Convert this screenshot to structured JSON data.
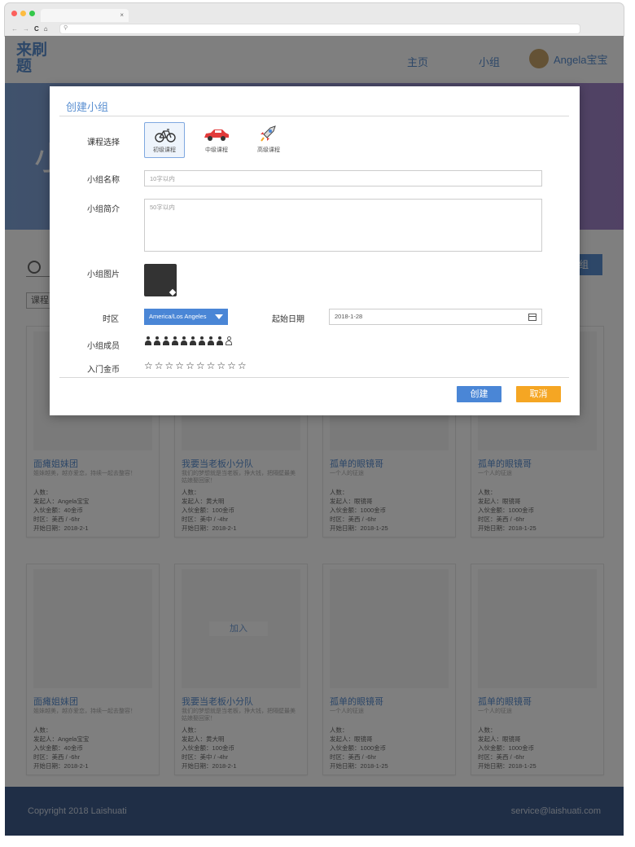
{
  "browser": {
    "tab_close": "×"
  },
  "header": {
    "logo": "来刷题",
    "nav": [
      "主页",
      "小组"
    ],
    "user_name": "Angela宝宝"
  },
  "banner": {
    "title": "小"
  },
  "search": {
    "button_label": "组"
  },
  "filter": {
    "course_label": "课程"
  },
  "cards": [
    {
      "title": "面瘫姐妹团",
      "desc": "姐妹越美，越亦爱恋，持续一起去整容！",
      "count_label": "人数：",
      "owner": "发起人：Angela宝宝",
      "fee": "入伙金额：40金币",
      "tz": "时区：美西 / -6hr",
      "start": "开始日期：2018-2-1"
    },
    {
      "title": "我要当老板小分队",
      "desc": "我们的梦想就是当老板，挣大钱，把隔壁最美姑娘娶回家！",
      "count_label": "人数：",
      "owner": "发起人：黄大明",
      "fee": "入伙金额：100金币",
      "tz": "时区：美中 / -4hr",
      "start": "开始日期：2018-2-1"
    },
    {
      "title": "孤单的眼镜哥",
      "desc": "一个人的征途",
      "count_label": "人数：",
      "owner": "发起人：眼镜哥",
      "fee": "入伙金额：1000金币",
      "tz": "时区：美西 / -6hr",
      "start": "开始日期：2018-1-25"
    },
    {
      "title": "孤单的眼镜哥",
      "desc": "一个人的征途",
      "count_label": "人数：",
      "owner": "发起人：眼镜哥",
      "fee": "入伙金额：1000金币",
      "tz": "时区：美西 / -6hr",
      "start": "开始日期：2018-1-25"
    },
    {
      "title": "面瘫姐妹团",
      "desc": "姐妹越美，越亦爱恋，持续一起去整容！",
      "count_label": "人数：",
      "owner": "发起人：Angela宝宝",
      "fee": "入伙金额：40金币",
      "tz": "时区：美西 / -6hr",
      "start": "开始日期：2018-2-1"
    },
    {
      "title": "我要当老板小分队",
      "desc": "我们的梦想就是当老板，挣大钱，把隔壁最美姑娘娶回家！",
      "count_label": "人数：",
      "owner": "发起人：黄大明",
      "fee": "入伙金额：100金币",
      "tz": "时区：美中 / -4hr",
      "start": "开始日期：2018-2-1",
      "join_label": "加入"
    },
    {
      "title": "孤单的眼镜哥",
      "desc": "一个人的征途",
      "count_label": "人数：",
      "owner": "发起人：眼镜哥",
      "fee": "入伙金额：1000金币",
      "tz": "时区：美西 / -6hr",
      "start": "开始日期：2018-1-25"
    },
    {
      "title": "孤单的眼镜哥",
      "desc": "一个人的征途",
      "count_label": "人数：",
      "owner": "发起人：眼镜哥",
      "fee": "入伙金额：1000金币",
      "tz": "时区：美西 / -6hr",
      "start": "开始日期：2018-1-25"
    }
  ],
  "footer": {
    "copyright": "Copyright 2018 Laishuati",
    "email": "service@laishuati.com"
  },
  "modal": {
    "title": "创建小组",
    "labels": {
      "course": "课程选择",
      "name": "小组名称",
      "intro": "小组简介",
      "image": "小组图片",
      "timezone": "时区",
      "start_date": "起始日期",
      "members": "小组成员",
      "coins": "入门金币"
    },
    "courses": [
      {
        "label": "初级课程",
        "icon": "bicycle-icon",
        "selected": true
      },
      {
        "label": "中级课程",
        "icon": "car-icon",
        "selected": false
      },
      {
        "label": "高级课程",
        "icon": "rocket-icon",
        "selected": false
      }
    ],
    "name_placeholder": "10字以内",
    "intro_placeholder": "50字以内",
    "timezone_value": "America/Los Angeles",
    "start_date_value": "2018-1-28",
    "members_filled": 9,
    "members_total": 10,
    "coins_filled": 0,
    "coins_total": 10,
    "create_label": "创建",
    "cancel_label": "取消",
    "colors": {
      "accent": "#5a8fd1",
      "create": "#4a86d6",
      "cancel": "#f5a623"
    }
  }
}
